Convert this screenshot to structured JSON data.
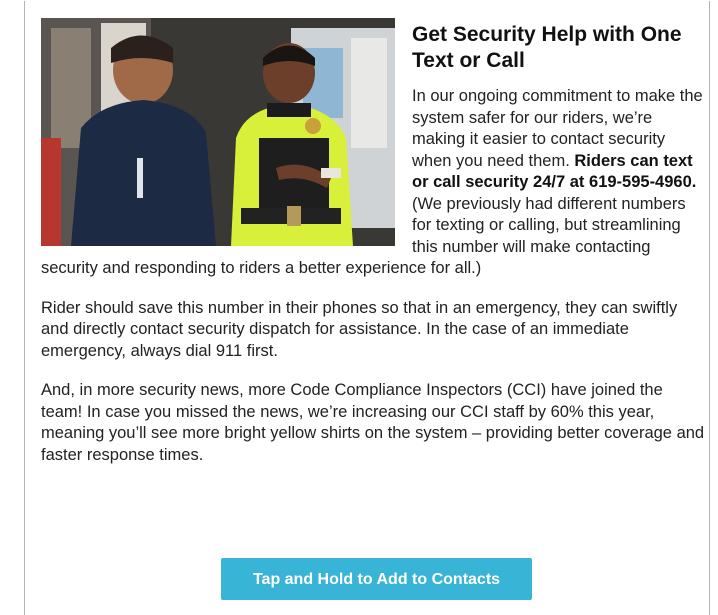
{
  "article": {
    "heading": "Get Security Help with One Text or Call",
    "intro_part1": "In our ongoing commitment to make the system safer for our riders, we’re making it easier to contact security when you need them. ",
    "intro_bold": "Riders can text or call security 24/7 at 619-595-4960.",
    "intro_part2": " (We previously had different numbers for texting or calling, but streamlining this number will make contacting security and responding to riders a better experience for all.)",
    "paragraph2": "Rider should save this number in their phones so that in an emergency, they can swiftly and directly contact security dispatch for assistance. In the case of an immediate emergency, always dial 911 first.",
    "paragraph3": "And, in more security news, more Code Compliance Inspectors (CCI) have joined the team! In case you missed the news, we’re increasing our CCI staff by 60% this year, meaning you’ll see more bright yellow shirts on the system – providing better coverage and faster response times.",
    "cta_label": "Tap and Hold to Add to Contacts"
  },
  "colors": {
    "cta_background": "#38b5d6",
    "cta_text": "#ffffff",
    "officer_shirt": "#d8f03a"
  }
}
